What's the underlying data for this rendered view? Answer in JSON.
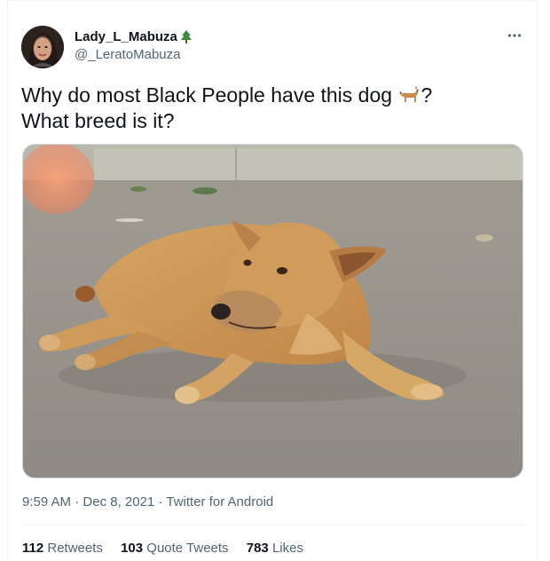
{
  "user": {
    "display_name": "Lady_L_Mabuza",
    "handle": "@_LeratoMabuza",
    "name_emoji": "evergreen-tree-icon"
  },
  "tweet": {
    "line1_before_emoji": "Why do most Black People have this dog ",
    "line1_after_emoji": "?",
    "line2": "What breed is it?",
    "inline_emoji": "dog-icon",
    "time": "9:59 AM",
    "date": "Dec 8, 2021",
    "source": "Twitter for Android"
  },
  "stats": {
    "retweets_count": "112",
    "retweets_label": "Retweets",
    "quotes_count": "103",
    "quotes_label": "Quote Tweets",
    "likes_count": "783",
    "likes_label": "Likes"
  },
  "colors": {
    "text": "#0f1419",
    "secondary": "#536471",
    "border": "#eff3f4"
  }
}
